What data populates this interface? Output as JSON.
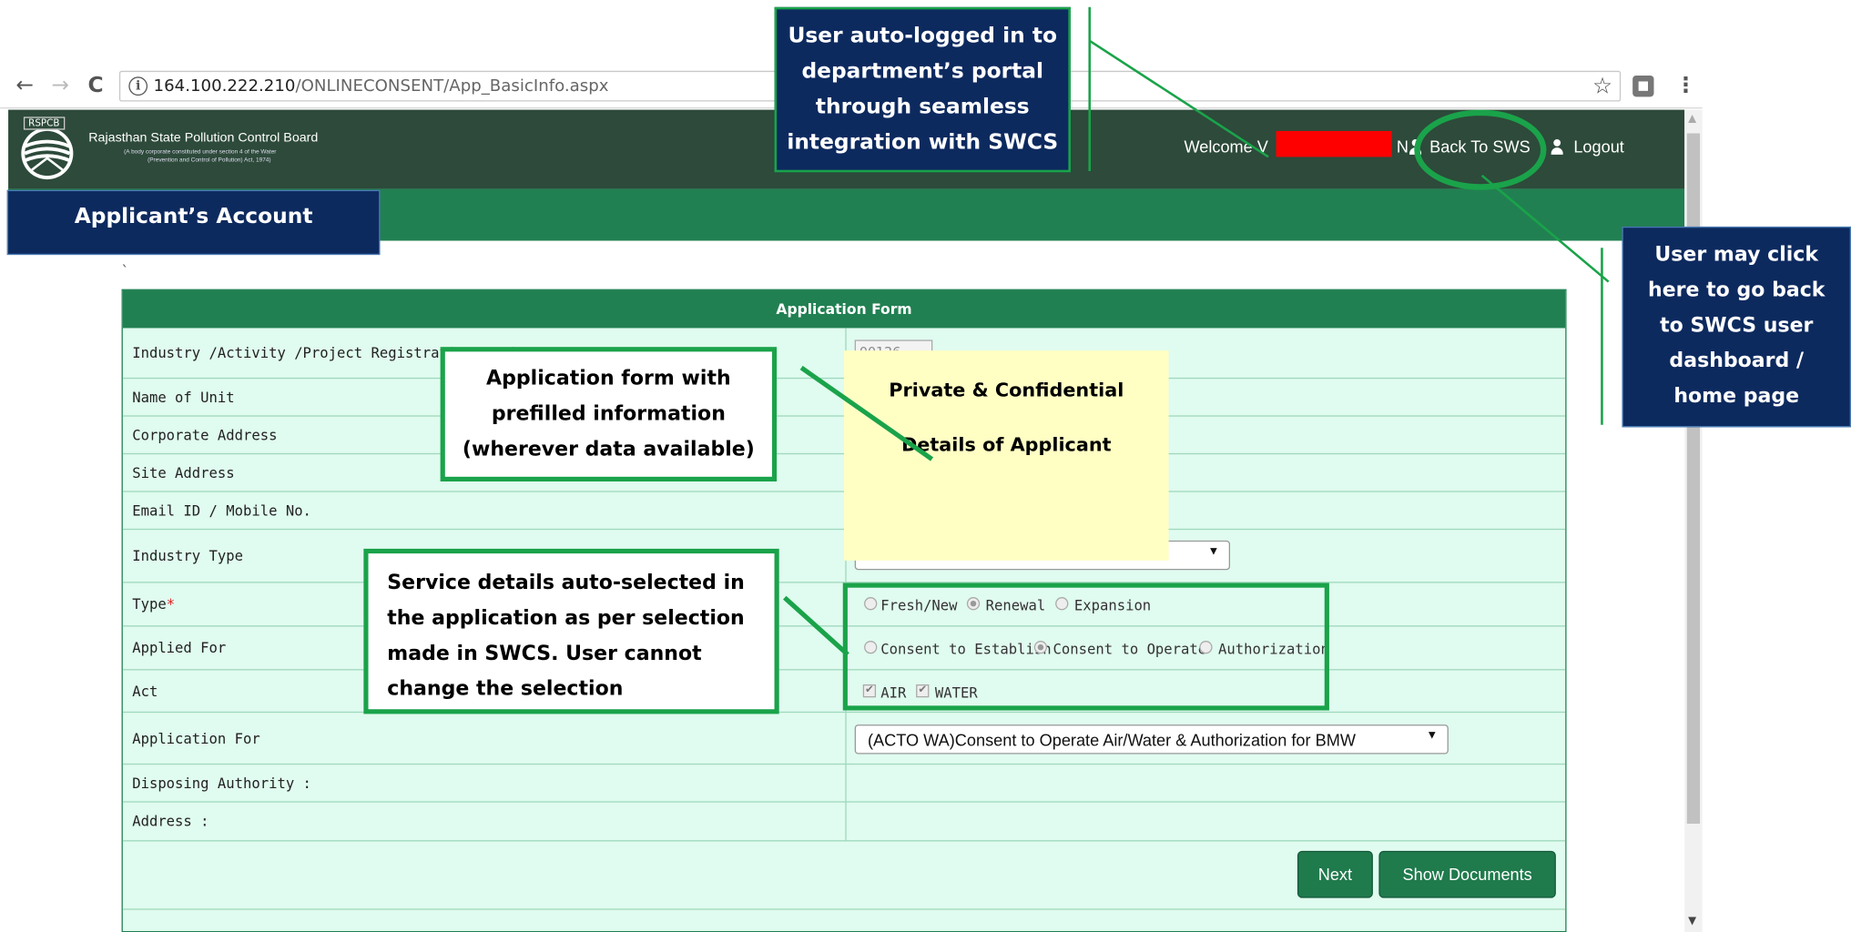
{
  "browser": {
    "back": "←",
    "forward": "→",
    "reload": "C",
    "info": "i",
    "url_host": "164.100.222.210",
    "url_path": "/ONLINECONSENT/App_BasicInfo.aspx",
    "star": "☆",
    "menu": "⋮"
  },
  "header": {
    "logo_abbr": "RSPCB",
    "org_name": "Rajasthan State Pollution Control Board",
    "org_sub1": "(A body corporate constituted under section 4 of the Water",
    "org_sub2": "(Prevention and Control of Pollution) Act, 1974)",
    "welcome": "Welcome V",
    "welcome_tail": "N",
    "back_link": "Back To SWS",
    "logout_link": "Logout"
  },
  "tick": "`",
  "form": {
    "title": "Application Form",
    "rows": [
      {
        "label": "Industry /Activity /Project Registration No (U"
      },
      {
        "label": "Name of Unit"
      },
      {
        "label": "Corporate Address"
      },
      {
        "label": "Site Address"
      },
      {
        "label": "Email ID / Mobile No."
      },
      {
        "label": "Industry Type"
      },
      {
        "label": "Type"
      },
      {
        "label": "Applied For"
      },
      {
        "label": "Act"
      },
      {
        "label": "Application For"
      },
      {
        "label": "Disposing Authority :"
      },
      {
        "label": "Address :"
      }
    ],
    "required_mark": "*",
    "reg_no_value": "00126",
    "type_options": [
      "Fresh/New",
      "Renewal",
      "Expansion"
    ],
    "type_selected": "Renewal",
    "applied_options": [
      "Consent to Establish",
      "Consent to Operate",
      "Authorization"
    ],
    "applied_selected": "Consent to Operate",
    "act_options": [
      "AIR",
      "WATER"
    ],
    "act_checked": [
      "AIR",
      "WATER"
    ],
    "check_mark": "✔",
    "dropdown_arrow": "▼",
    "application_for": "(ACTO WA)Consent to Operate Air/Water & Authorization for BMW",
    "next_label": "Next",
    "show_docs_label": "Show Documents"
  },
  "annotations": {
    "auto_login": [
      "User auto-logged in to",
      "department’s portal",
      "through seamless",
      "integration with SWCS"
    ],
    "applicant_account": "Applicant’s Account",
    "go_back": [
      "User may click",
      "here to go back",
      "to SWCS user",
      "dashboard /",
      "home page"
    ],
    "prefilled": [
      "Application form with",
      "prefilled information",
      "(wherever data available)"
    ],
    "sticky": [
      "Private & Confidential",
      "Details of Applicant"
    ],
    "service": [
      "Service details auto-selected in",
      "the application as per selection",
      "made in SWCS. User cannot",
      "change the selection"
    ]
  },
  "colors": {
    "header_dark": "#2d4a3a",
    "band_green": "#218052",
    "form_bg": "#e0fbef",
    "annotation_navy": "#0d2a5f",
    "annotation_green": "#1aa34a",
    "sticky_yellow": "#ffffc4",
    "redaction": "#ff0000"
  }
}
